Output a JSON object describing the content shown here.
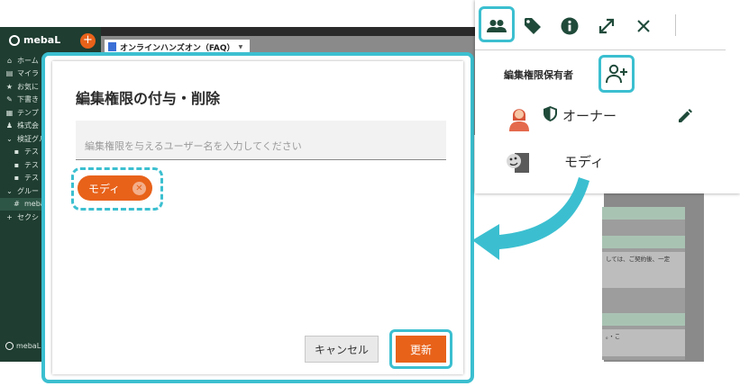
{
  "app": {
    "logo": "mebaL",
    "add_label": "+",
    "nav": [
      {
        "icon": "home-icon",
        "glyph": "⌂",
        "label": "ホーム",
        "indent": false
      },
      {
        "icon": "page-icon",
        "glyph": "▤",
        "label": "マイラ",
        "indent": false
      },
      {
        "icon": "star-icon",
        "glyph": "★",
        "label": "お気に",
        "indent": false
      },
      {
        "icon": "draft-icon",
        "glyph": "✎",
        "label": "下書き",
        "indent": false
      },
      {
        "icon": "template-icon",
        "glyph": "▦",
        "label": "テンプ",
        "indent": false
      },
      {
        "icon": "company-icon",
        "glyph": "♟",
        "label": "株式会",
        "indent": false
      },
      {
        "icon": "group-icon",
        "glyph": "⌄",
        "label": "検証グル",
        "indent": false
      },
      {
        "icon": "lock-icon",
        "glyph": "▪",
        "label": "テス",
        "indent": true
      },
      {
        "icon": "lock-icon",
        "glyph": "▪",
        "label": "テス",
        "indent": true
      },
      {
        "icon": "lock-icon",
        "glyph": "▪",
        "label": "テス",
        "indent": true
      },
      {
        "icon": "group-icon",
        "glyph": "⌄",
        "label": "グルー",
        "indent": false
      },
      {
        "icon": "hash-icon",
        "glyph": "#",
        "label": "meba",
        "indent": true,
        "active": true
      },
      {
        "icon": "plus-icon",
        "glyph": "+",
        "label": "セクシ",
        "indent": false
      }
    ],
    "footer_label": "mebaL",
    "doc_tab_title": "オンラインハンズオン（FAQ）",
    "bg_card_text_1": "しては、ご契約後、一定",
    "bg_card_text_2": "。・こ"
  },
  "modal": {
    "title": "編集権限の付与・削除",
    "input_placeholder": "編集権限を与えるユーザー名を入力してください",
    "input_value": "",
    "chip_label": "モディ",
    "chip_remove_glyph": "✕",
    "cancel_label": "キャンセル",
    "update_label": "更新"
  },
  "panel": {
    "toolbar_icons": [
      "people-icon",
      "tag-icon",
      "info-icon",
      "expand-icon",
      "close-icon"
    ],
    "holder_label": "編集権限保有者",
    "owner_role": "オーナー",
    "member_name": "モディ"
  },
  "colors": {
    "accent": "#3bbfd0",
    "primary": "#e8621a",
    "icon": "#1f4a3a",
    "sidebar": "#1f3d31"
  }
}
